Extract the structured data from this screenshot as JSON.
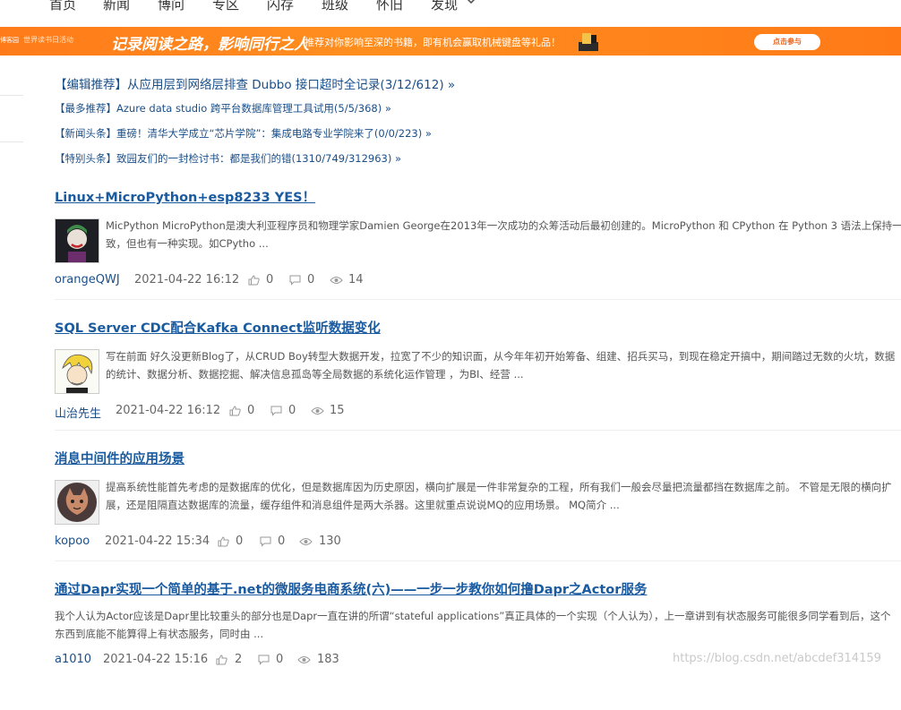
{
  "nav": {
    "items": [
      "首页",
      "新闻",
      "博问",
      "专区",
      "闪存",
      "班级",
      "怀旧",
      "发现"
    ]
  },
  "banner": {
    "logo": "博客园",
    "small_text": "世界读书日活动",
    "slogan": "记录阅读之路，影响同行之人",
    "desc": "推荐对你影响至深的书籍，即有机会赢取机械键盘等礼品！",
    "button": "点击参与"
  },
  "news": [
    "【编辑推荐】从应用层到网络层排查 Dubbo 接口超时全记录(3/12/612) »",
    "【最多推荐】Azure data studio 跨平台数据库管理工具试用(5/5/368) »",
    "【新闻头条】重磅！清华大学成立“芯片学院”：集成电路专业学院来了(0/0/223) »",
    "【特别头条】致园友们的一封检讨书：都是我们的错(1310/749/312963) »"
  ],
  "posts": [
    {
      "title": "Linux+MicroPython+esp8233 YES！",
      "summary": "MicPython MicroPython是澳大利亚程序员和物理学家Damien George在2013年一次成功的众筹活动后最初创建的。MicroPython 和 CPython 在 Python 3 语法上保持一致，但也有一种实现。如CPytho ...",
      "author": "orangeQWJ",
      "date": "2021-04-22 16:12",
      "likes": "0",
      "comments": "0",
      "views": "14"
    },
    {
      "title": "SQL Server CDC配合Kafka Connect监听数据变化",
      "summary": "写在前面 好久没更新Blog了，从CRUD Boy转型大数据开发，拉宽了不少的知识面，从今年年初开始筹备、组建、招兵买马，到现在稳定开搞中，期间踏过无数的火坑，数据的统计、数据分析、数据挖掘、解决信息孤岛等全局数据的系统化运作管理 ，为BI、经营 ...",
      "author": "山治先生",
      "date": "2021-04-22 16:12",
      "likes": "0",
      "comments": "0",
      "views": "15"
    },
    {
      "title": "消息中间件的应用场景",
      "summary": "提高系统性能首先考虑的是数据库的优化，但是数据库因为历史原因，横向扩展是一件非常复杂的工程，所有我们一般会尽量把流量都挡在数据库之前。 不管是无限的横向扩展，还是阻隔直达数据库的流量，缓存组件和消息组件是两大杀器。这里就重点说说MQ的应用场景。 MQ简介 ...",
      "author": "kopoo",
      "date": "2021-04-22 15:34",
      "likes": "0",
      "comments": "0",
      "views": "130"
    },
    {
      "title": "通过Dapr实现一个简单的基于.net的微服务电商系统(六)——一步一步教你如何撸Dapr之Actor服务",
      "summary": "我个人认为Actor应该是Dapr里比较重头的部分也是Dapr一直在讲的所谓“stateful applications”真正具体的一个实现（个人认为），上一章讲到有状态服务可能很多同学看到后，这个东西到底能不能算得上有状态服务，同时由 ...",
      "author": "a1010",
      "date": "2021-04-22 15:16",
      "likes": "2",
      "comments": "0",
      "views": "183"
    }
  ],
  "watermark": "https://blog.csdn.net/abcdef314159",
  "colors": {
    "banner": "#ff8a1f",
    "link": "#1a5ba0",
    "news": "#1a4f8a"
  }
}
